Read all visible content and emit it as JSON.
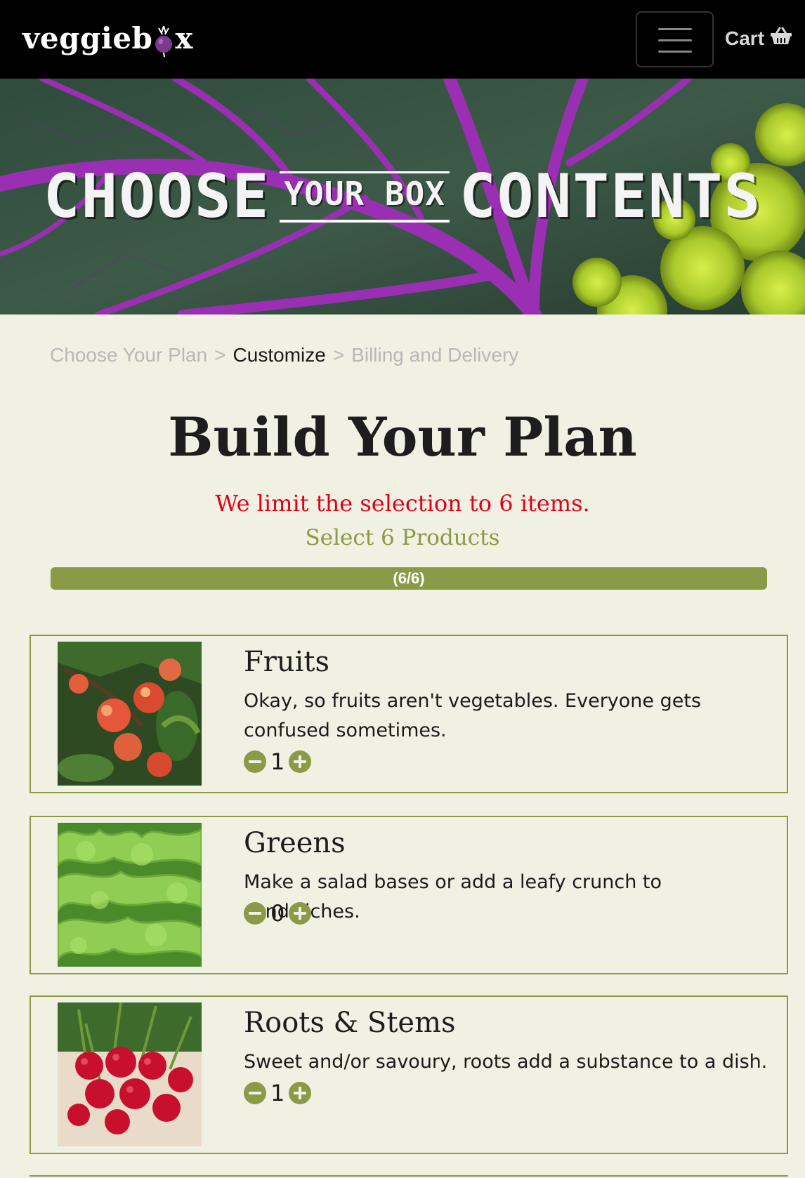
{
  "brand": {
    "logo_left": "veggieb",
    "logo_right": "x"
  },
  "nav": {
    "cart_label": "Cart"
  },
  "hero": {
    "title_left": "CHOOSE",
    "title_mid": "YOUR BOX",
    "title_right": "CONTENTS"
  },
  "breadcrumb": {
    "step1": "Choose Your Plan",
    "sep": ">",
    "step2": "Customize",
    "step3": "Billing and Delivery"
  },
  "header": {
    "title": "Build Your Plan",
    "limit": "We limit the selection to 6 items.",
    "subtitle": "Select 6 Products"
  },
  "progress": {
    "label": "(6/6)",
    "fraction": 1.0
  },
  "products": [
    {
      "name": "Fruits",
      "desc": "Okay, so fruits aren't vegetables. Everyone gets confused sometimes.",
      "qty": "1"
    },
    {
      "name": "Greens",
      "desc": "Make a salad bases or add a leafy crunch to sandwiches.",
      "qty": "0"
    },
    {
      "name": "Roots & Stems",
      "desc": "Sweet and/or savoury, roots add a substance to a dish.",
      "qty": "1"
    }
  ],
  "colors": {
    "accent": "#8b9a46",
    "alert": "#e0001b",
    "background": "#f1f1e3",
    "navbar": "#000000"
  },
  "icons": {
    "cart": "basket-icon",
    "menu": "hamburger-icon",
    "decrease": "minus-circle-icon",
    "increase": "plus-circle-icon"
  }
}
